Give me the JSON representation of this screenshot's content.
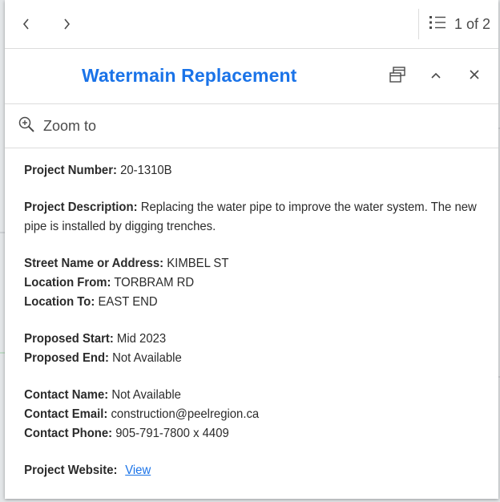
{
  "navigation": {
    "previous_icon": "chevron-left-icon",
    "next_icon": "chevron-right-icon",
    "feature_list_icon": "list-icon",
    "feature_count": "1 of 2"
  },
  "popup": {
    "title": "Watermain Replacement",
    "dock_icon": "dock-icon",
    "collapse_icon": "chevron-up-icon",
    "close_icon": "close-icon",
    "title_color": "#1a73e8"
  },
  "actions": {
    "zoom_to_label": "Zoom to",
    "zoom_icon": "zoom-in-icon"
  },
  "fields": {
    "project_number": {
      "label": "Project Number:",
      "value": "20-1310B"
    },
    "project_description": {
      "label": "Project Description:",
      "value": "Replacing the water pipe to improve the water system. The new pipe is installed by digging trenches."
    },
    "street": {
      "label": "Street Name or Address:",
      "value": "KIMBEL ST"
    },
    "location_from": {
      "label": "Location From:",
      "value": "TORBRAM RD"
    },
    "location_to": {
      "label": "Location To:",
      "value": "EAST END"
    },
    "proposed_start": {
      "label": "Proposed Start:",
      "value": "Mid 2023"
    },
    "proposed_end": {
      "label": "Proposed End:",
      "value": "Not Available"
    },
    "contact_name": {
      "label": "Contact Name:",
      "value": "Not Available"
    },
    "contact_email": {
      "label": "Contact Email:",
      "value": "construction@peelregion.ca"
    },
    "contact_phone": {
      "label": "Contact Phone:",
      "value": "905-791-7800 x 4409"
    },
    "project_website": {
      "label": "Project Website:",
      "link_text": "View"
    }
  }
}
